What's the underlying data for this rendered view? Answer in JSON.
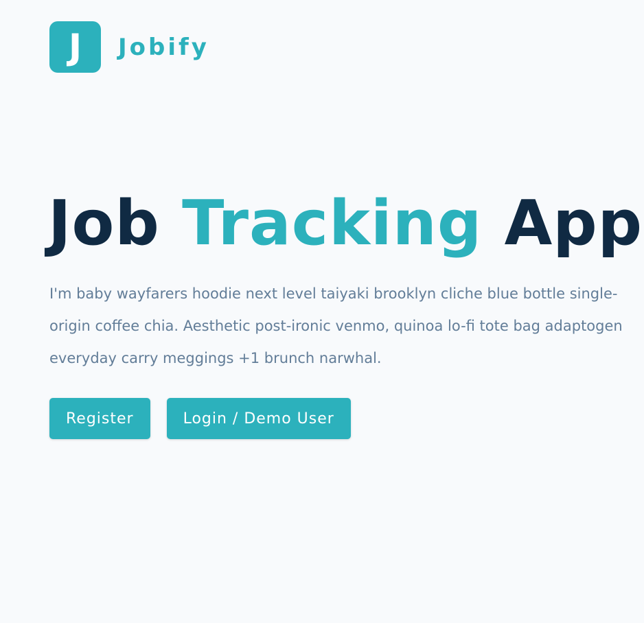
{
  "brand": {
    "logo_letter": "J",
    "name": "Jobify"
  },
  "hero": {
    "title_part1": "Job",
    "title_accent": "Tracking",
    "title_part2": "App",
    "description": "I'm baby wayfarers hoodie next level taiyaki brooklyn cliche blue bottle single-origin coffee chia. Aesthetic post-ironic venmo, quinoa lo-fi tote bag adaptogen everyday carry meggings +1 brunch narwhal."
  },
  "actions": {
    "register_label": "Register",
    "login_label": "Login / Demo User"
  },
  "colors": {
    "primary": "#2cb1bc",
    "heading": "#102a43",
    "body_text": "#627d98",
    "background": "#f8fafc"
  }
}
